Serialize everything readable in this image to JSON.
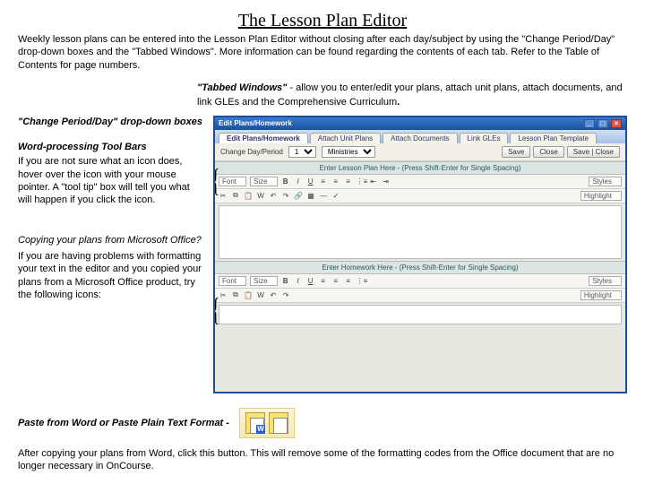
{
  "title": "The Lesson Plan Editor",
  "intro": "Weekly lesson plans can be entered into the Lesson Plan Editor without closing after each day/subject by using the \"Change Period/Day\" drop-down boxes and the \"Tabbed Windows\".  More information can be found regarding the contents of each tab.  Refer to the Table of Contents for page numbers.",
  "tabbed": {
    "label": "\"Tabbed Windows\"",
    "text": " - allow you to enter/edit your plans, attach unit plans, attach documents, and link GLEs and the Comprehensive Curriculum"
  },
  "left": {
    "change_label": "\"Change Period/Day\" drop-down boxes",
    "wp_label": "Word-processing Tool Bars",
    "wp_text": "If you are not sure what an icon does, hover over the icon with your mouse pointer.   A \"tool tip\" box will tell you what will happen if you click the icon.",
    "copy_q": "Copying your plans from Microsoft Office?",
    "copy_text": "If you are having problems with formatting your text in the editor and you copied your plans from a Microsoft Office product, try the following icons:"
  },
  "app": {
    "title": "Edit Plans/Homework",
    "tabs": [
      "Edit Plans/Homework",
      "Attach Unit Plans",
      "Attach Documents",
      "Link GLEs",
      "Lesson Plan Template"
    ],
    "change_label": "Change Day/Period",
    "day_opts": "1",
    "period_opts": "Ministries",
    "save": "Save",
    "close": "Close",
    "saveclose": "Save | Close",
    "panel1": "Enter Lesson Plan Here - (Press Shift-Enter for Single Spacing)",
    "panel2": "Enter Homework Here - (Press Shift-Enter for Single Spacing)",
    "font": "Font",
    "size": "Size",
    "styles": "Styles",
    "highlight": "Highlight"
  },
  "paste": {
    "label": "Paste from Word or Paste Plain Text Format -",
    "after": "After copying your plans from Word, click this button.  This will remove some of the formatting codes from the Office document that are no longer necessary in OnCourse."
  }
}
